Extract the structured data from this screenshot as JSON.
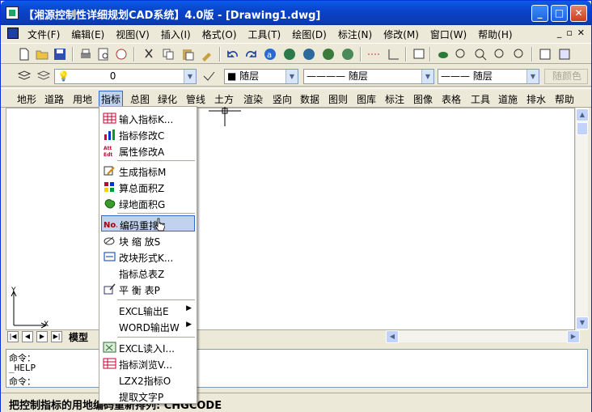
{
  "window": {
    "title": "【湘源控制性详细规划CAD系统】4.0版 - [Drawing1.dwg]"
  },
  "title_buttons": {
    "minimize": "_",
    "maximize": "□",
    "close": "✕"
  },
  "menubar": {
    "items": [
      "文件(F)",
      "编辑(E)",
      "视图(V)",
      "插入(I)",
      "格式(O)",
      "工具(T)",
      "绘图(D)",
      "标注(N)",
      "修改(M)",
      "窗口(W)",
      "帮助(H)"
    ],
    "mdi": [
      "_",
      "▫",
      "✕"
    ]
  },
  "layer_toolbar": {
    "layer_value": "0",
    "color_value": "■ 随层",
    "linetype_value": "———— 随层",
    "lineweight_value": "——— 随层",
    "plotstyle_value": "随颜色"
  },
  "category_toolbar": {
    "items": [
      "地形",
      "道路",
      "用地",
      "指标",
      "总图",
      "绿化",
      "管线",
      "土方",
      "渲染",
      "竖向",
      "数据",
      "图则",
      "图库",
      "标注",
      "图像",
      "表格",
      "工具",
      "道施",
      "排水",
      "帮助"
    ],
    "active": "指标"
  },
  "dropdown": {
    "items": [
      {
        "label": "输入指标K...",
        "icon": "table-icon"
      },
      {
        "label": "指标修改C",
        "icon": "bar-chart-icon"
      },
      {
        "label": "属性修改A",
        "icon": "att-edit-icon"
      },
      {
        "label": "生成指标M",
        "icon": "generate-icon"
      },
      {
        "label": "算总面积Z",
        "icon": "area-sum-icon"
      },
      {
        "label": "绿地面积G",
        "icon": "green-area-icon"
      },
      {
        "label": "编码重排",
        "icon": "number-icon"
      },
      {
        "label": "块 缩 放S",
        "icon": "block-scale-icon"
      },
      {
        "label": "改块形式K...",
        "icon": "block-form-icon"
      },
      {
        "label": "指标总表Z",
        "icon": ""
      },
      {
        "label": "平 衡 表P",
        "icon": "balance-table-icon"
      },
      {
        "label": "EXCL输出E",
        "icon": ""
      },
      {
        "label": "WORD输出W",
        "icon": ""
      },
      {
        "label": "EXCL读入I...",
        "icon": "excel-read-icon"
      },
      {
        "label": "指标浏览V...",
        "icon": "browse-icon"
      },
      {
        "label": "LZX2指标O",
        "icon": ""
      },
      {
        "label": "提取文字P",
        "icon": ""
      }
    ],
    "highlighted": "编码重排"
  },
  "tabs": {
    "model": "模型"
  },
  "command": {
    "line1": "命令：",
    "line2": " _HELP",
    "line3": "命令："
  },
  "status": {
    "text": "把控制指标的用地编码重新排列: CHGCODE"
  },
  "axis": {
    "x": "X",
    "y": "Y"
  },
  "colors": {
    "titlebar": "#0a5ce8",
    "highlight": "#c1d2ee",
    "highlight_border": "#316ac5"
  }
}
